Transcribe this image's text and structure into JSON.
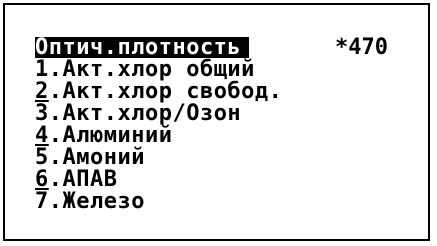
{
  "header": {
    "title": "Оптич.плотность",
    "value": "*470"
  },
  "menu": {
    "items": [
      {
        "number": "1",
        "label": ".Акт.хлор общий"
      },
      {
        "number": "2",
        "label": ".Акт.хлор свобод."
      },
      {
        "number": "3",
        "label": ".Акт.хлор/Озон"
      },
      {
        "number": "4",
        "label": ".Алюминий"
      },
      {
        "number": "5",
        "label": ".Амоний"
      },
      {
        "number": "6",
        "label": ".АПАВ"
      },
      {
        "number": "7",
        "label": ".Железо"
      }
    ]
  },
  "colors": {
    "background": "#ffffff",
    "foreground": "#000000",
    "highlight_bg": "#000000",
    "highlight_fg": "#ffffff"
  }
}
